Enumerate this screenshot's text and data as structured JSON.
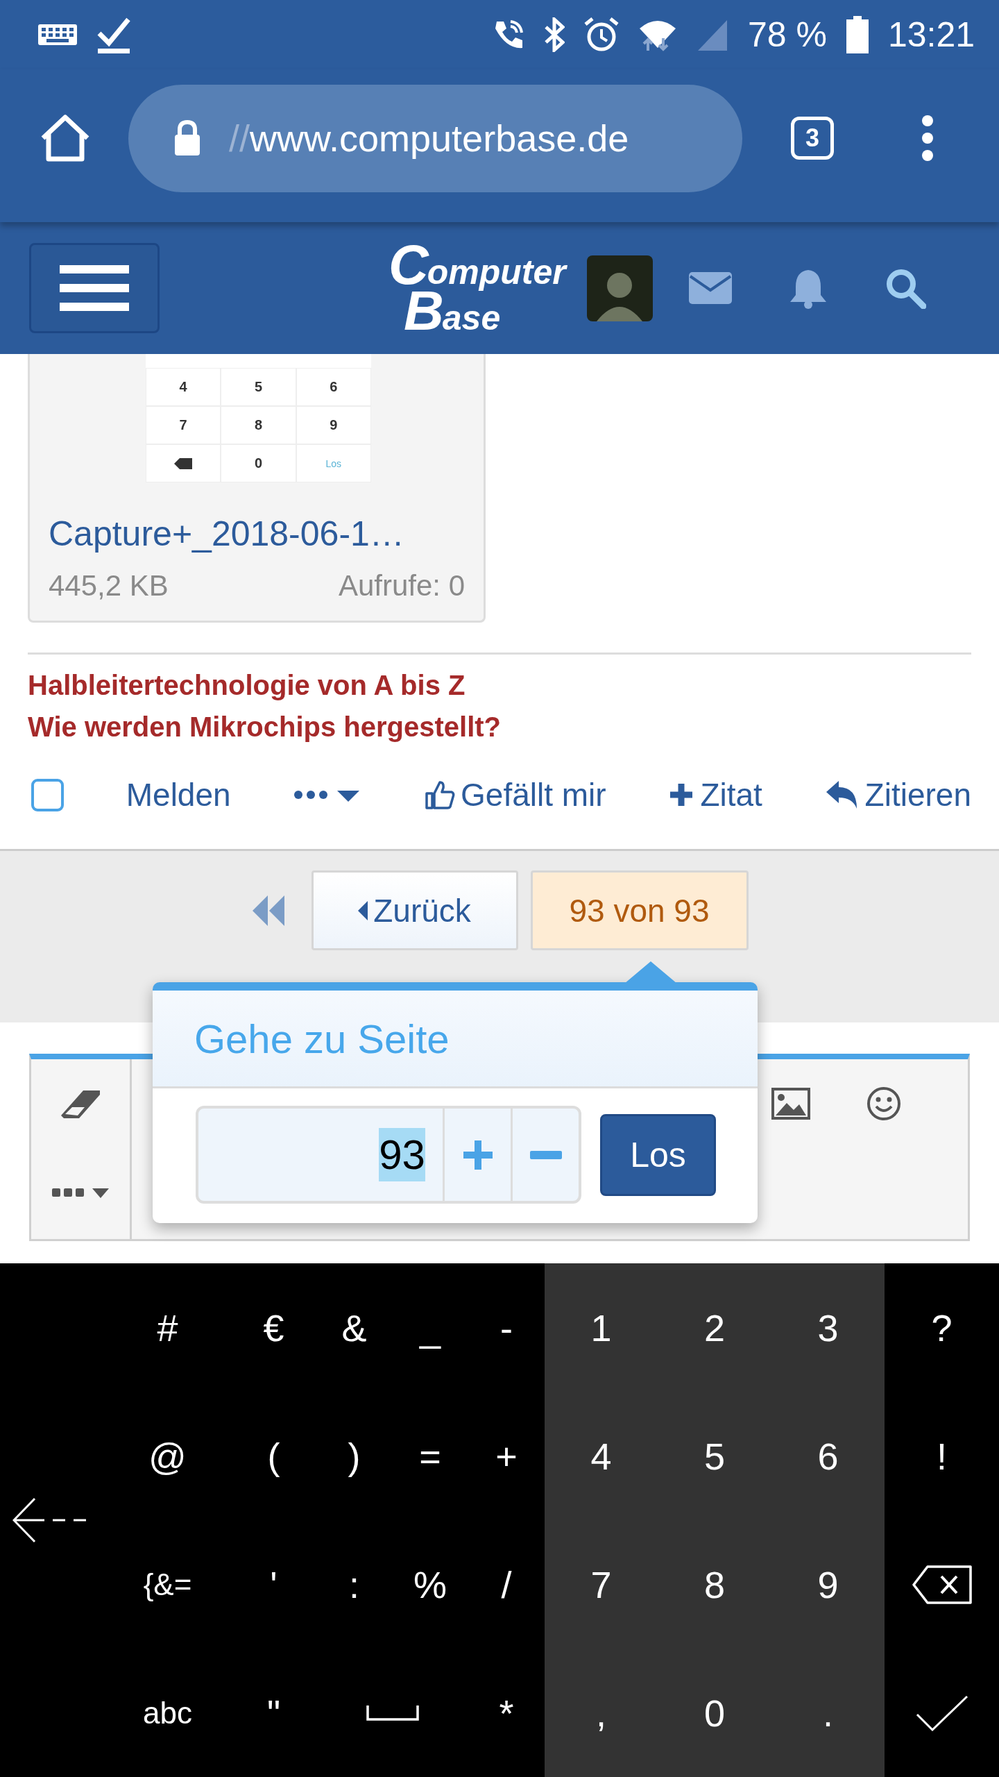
{
  "status_bar": {
    "battery": "78 %",
    "time": "13:21"
  },
  "browser": {
    "url_prefix": "//",
    "url": "www.computerbase.de",
    "tab_count": "3"
  },
  "site_header": {
    "logo_lines": [
      "Computer",
      "Base"
    ]
  },
  "attachment": {
    "thumbnail_keys": [
      {
        "kind": "digit",
        "label": "4"
      },
      {
        "kind": "digit",
        "label": "5"
      },
      {
        "kind": "digit",
        "label": "6"
      },
      {
        "kind": "digit",
        "label": "7"
      },
      {
        "kind": "digit",
        "label": "8"
      },
      {
        "kind": "digit",
        "label": "9"
      },
      {
        "kind": "delete"
      },
      {
        "kind": "digit",
        "label": "0"
      },
      {
        "kind": "action",
        "label": "Los"
      }
    ],
    "filename": "Capture+_2018-06-1…",
    "size": "445,2 KB",
    "views": "Aufrufe: 0"
  },
  "signature": [
    "Halbleitertechnologie von A bis Z",
    "Wie werden Mikrochips hergestellt?"
  ],
  "post_actions": {
    "select_checkbox": {
      "checked": false
    },
    "items": [
      {
        "kind": "report",
        "label": "Melden"
      },
      {
        "kind": "more"
      },
      {
        "kind": "like",
        "label": "Gefällt mir"
      },
      {
        "kind": "quote",
        "label": "Zitat"
      },
      {
        "kind": "reply",
        "label": "Zitieren"
      }
    ]
  },
  "pagination": [
    {
      "kind": "first"
    },
    {
      "kind": "prev",
      "label": "Zurück"
    },
    {
      "kind": "current",
      "label": "93 von 93"
    }
  ],
  "page_jump": {
    "title": "Gehe zu Seite",
    "value": "93",
    "value_selected": true,
    "button": "Los"
  },
  "keyboard": {
    "left_key": {
      "kind": "cursor_left"
    },
    "rows": [
      {
        "keys": [
          {
            "kind": "sym",
            "label": "#"
          },
          {
            "kind": "sym",
            "label": "€"
          },
          {
            "kind": "sym",
            "label": "&"
          },
          {
            "kind": "sym",
            "label": "_"
          },
          {
            "kind": "sym",
            "label": "-"
          },
          {
            "kind": "num",
            "label": "1"
          },
          {
            "kind": "num",
            "label": "2"
          },
          {
            "kind": "num",
            "label": "3"
          },
          {
            "kind": "sym",
            "label": "?"
          }
        ]
      },
      {
        "keys": [
          {
            "kind": "sym",
            "label": "@"
          },
          {
            "kind": "sym",
            "label": "("
          },
          {
            "kind": "sym",
            "label": ")"
          },
          {
            "kind": "sym",
            "label": "="
          },
          {
            "kind": "sym",
            "label": "+"
          },
          {
            "kind": "num",
            "label": "4"
          },
          {
            "kind": "num",
            "label": "5"
          },
          {
            "kind": "num",
            "label": "6"
          },
          {
            "kind": "sym",
            "label": "!"
          }
        ]
      },
      {
        "keys": [
          {
            "kind": "mode",
            "label": "{&="
          },
          {
            "kind": "sym",
            "label": "'"
          },
          {
            "kind": "sym",
            "label": ":"
          },
          {
            "kind": "sym",
            "label": "%"
          },
          {
            "kind": "sym",
            "label": "/"
          },
          {
            "kind": "num",
            "label": "7"
          },
          {
            "kind": "num",
            "label": "8"
          },
          {
            "kind": "num",
            "label": "9"
          },
          {
            "kind": "backspace"
          }
        ]
      },
      {
        "keys": [
          {
            "kind": "mode",
            "label": "abc"
          },
          {
            "kind": "sym",
            "label": "\""
          },
          {
            "kind": "space"
          },
          {
            "kind": "sym",
            "label": "*"
          },
          {
            "kind": "num",
            "label": ","
          },
          {
            "kind": "num",
            "label": "0"
          },
          {
            "kind": "num",
            "label": "."
          },
          {
            "kind": "enter"
          }
        ]
      }
    ]
  }
}
